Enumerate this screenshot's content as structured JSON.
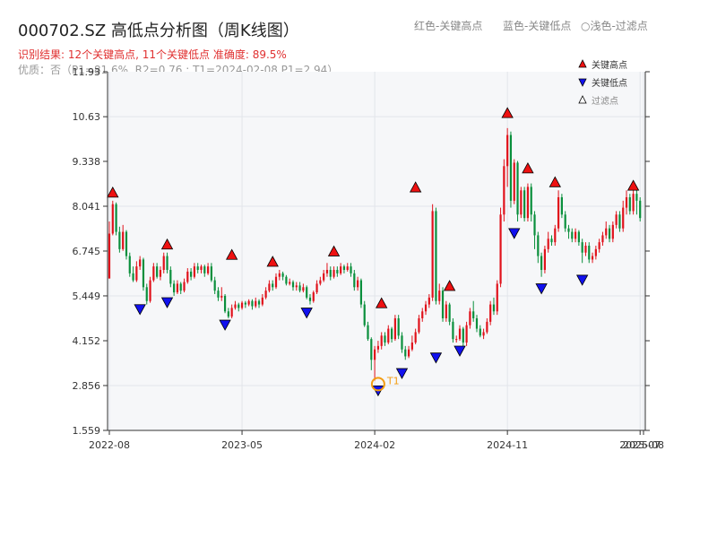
{
  "title": "000702.SZ 高低点分析图（周K线图）",
  "legend_text": {
    "red": "红色-关键高点",
    "blue": "蓝色-关键低点",
    "light": "○浅色-过滤点"
  },
  "info_line1": "识别结果: 12个关键高点, 11个关键低点  准确度: 89.5%",
  "info_line2": "优质：否（P1=81.6%, R2=0.76 ; T1=2024-02-08 P1=2.94）",
  "legend_box": {
    "high": "关键高点",
    "low": "关键低点",
    "filtered": "过滤点"
  },
  "colors": {
    "up": "#e0121b",
    "down": "#0a8f3c",
    "high_marker": "#ee1111",
    "low_marker": "#1111ee",
    "t1": "#f39c12",
    "plot_bg": "#f6f7f9"
  },
  "chart_data": {
    "type": "candlestick",
    "x_range_index": [
      0,
      157
    ],
    "ylim": [
      1.559,
      11.93
    ],
    "y_ticks": [
      "11.93",
      "10.63",
      "9.338",
      "8.041",
      "6.745",
      "5.449",
      "4.152",
      "2.856",
      "1.559"
    ],
    "x_ticks": [
      {
        "label": "2022-08",
        "index": 0
      },
      {
        "label": "2023-05",
        "index": 39
      },
      {
        "label": "2024-02",
        "index": 78
      },
      {
        "label": "2024-11",
        "index": 117
      },
      {
        "label": "2025-07",
        "index": 156
      },
      {
        "label": "2025-08",
        "index": 157
      }
    ],
    "candles": [
      [
        5.95,
        7.25,
        6.1,
        7.6
      ],
      [
        7.25,
        8.1,
        7.2,
        8.2
      ],
      [
        8.1,
        7.3,
        7.2,
        8.15
      ],
      [
        7.3,
        6.8,
        6.7,
        7.45
      ],
      [
        6.8,
        7.3,
        6.75,
        7.5
      ],
      [
        7.3,
        6.6,
        6.5,
        7.35
      ],
      [
        6.6,
        6.1,
        6.0,
        6.7
      ],
      [
        6.1,
        5.9,
        5.85,
        6.3
      ],
      [
        5.9,
        6.3,
        5.85,
        6.45
      ],
      [
        6.3,
        6.5,
        6.2,
        6.6
      ],
      [
        6.5,
        5.7,
        5.6,
        6.55
      ],
      [
        5.7,
        5.3,
        5.2,
        5.8
      ],
      [
        5.3,
        5.9,
        5.25,
        6.0
      ],
      [
        5.9,
        6.3,
        5.85,
        6.4
      ],
      [
        6.3,
        6.0,
        5.95,
        6.4
      ],
      [
        6.0,
        6.2,
        5.9,
        6.3
      ],
      [
        6.2,
        6.6,
        6.1,
        6.7
      ],
      [
        6.6,
        6.2,
        6.1,
        6.7
      ],
      [
        6.2,
        5.8,
        5.7,
        6.3
      ],
      [
        5.8,
        5.55,
        5.45,
        5.9
      ],
      [
        5.55,
        5.8,
        5.5,
        5.9
      ],
      [
        5.8,
        5.6,
        5.5,
        5.85
      ],
      [
        5.6,
        5.85,
        5.55,
        5.95
      ],
      [
        5.85,
        6.15,
        5.8,
        6.25
      ],
      [
        6.15,
        6.0,
        5.9,
        6.25
      ],
      [
        6.0,
        6.3,
        5.95,
        6.4
      ],
      [
        6.3,
        6.2,
        6.1,
        6.4
      ],
      [
        6.2,
        6.3,
        6.1,
        6.35
      ],
      [
        6.3,
        6.1,
        6.0,
        6.35
      ],
      [
        6.1,
        6.3,
        6.05,
        6.4
      ],
      [
        6.3,
        5.9,
        5.85,
        6.4
      ],
      [
        5.9,
        5.6,
        5.5,
        6.0
      ],
      [
        5.6,
        5.4,
        5.3,
        5.7
      ],
      [
        5.4,
        5.45,
        5.3,
        5.7
      ],
      [
        5.45,
        5.0,
        4.95,
        5.5
      ],
      [
        5.0,
        4.85,
        4.8,
        5.1
      ],
      [
        4.85,
        5.1,
        4.8,
        5.2
      ],
      [
        5.1,
        5.2,
        5.05,
        5.3
      ],
      [
        5.2,
        5.1,
        5.0,
        5.25
      ],
      [
        5.1,
        5.25,
        5.05,
        5.3
      ],
      [
        5.25,
        5.2,
        5.1,
        5.3
      ],
      [
        5.2,
        5.3,
        5.15,
        5.35
      ],
      [
        5.3,
        5.15,
        5.05,
        5.35
      ],
      [
        5.15,
        5.3,
        5.1,
        5.4
      ],
      [
        5.3,
        5.2,
        5.1,
        5.35
      ],
      [
        5.2,
        5.4,
        5.15,
        5.5
      ],
      [
        5.4,
        5.6,
        5.35,
        5.7
      ],
      [
        5.6,
        5.8,
        5.55,
        5.9
      ],
      [
        5.8,
        5.7,
        5.6,
        5.9
      ],
      [
        5.7,
        6.0,
        5.65,
        6.1
      ],
      [
        6.0,
        6.1,
        5.9,
        6.2
      ],
      [
        6.1,
        6.0,
        5.9,
        6.15
      ],
      [
        6.0,
        5.8,
        5.75,
        6.05
      ],
      [
        5.8,
        5.85,
        5.75,
        5.95
      ],
      [
        5.85,
        5.7,
        5.6,
        5.9
      ],
      [
        5.7,
        5.75,
        5.6,
        5.85
      ],
      [
        5.75,
        5.6,
        5.55,
        5.85
      ],
      [
        5.6,
        5.7,
        5.55,
        5.8
      ],
      [
        5.7,
        5.4,
        5.35,
        5.75
      ],
      [
        5.4,
        5.3,
        5.2,
        5.5
      ],
      [
        5.3,
        5.55,
        5.25,
        5.6
      ],
      [
        5.55,
        5.8,
        5.5,
        5.9
      ],
      [
        5.8,
        5.9,
        5.75,
        6.0
      ],
      [
        5.9,
        6.1,
        5.85,
        6.2
      ],
      [
        6.1,
        6.2,
        6.0,
        6.4
      ],
      [
        6.2,
        6.0,
        5.9,
        6.3
      ],
      [
        6.0,
        6.2,
        5.95,
        6.3
      ],
      [
        6.2,
        6.1,
        6.0,
        6.3
      ],
      [
        6.1,
        6.3,
        6.05,
        6.4
      ],
      [
        6.3,
        6.2,
        6.1,
        6.35
      ],
      [
        6.2,
        6.3,
        6.15,
        6.4
      ],
      [
        6.3,
        6.1,
        6.0,
        6.4
      ],
      [
        6.1,
        5.7,
        5.6,
        6.2
      ],
      [
        5.7,
        5.9,
        5.6,
        6.0
      ],
      [
        5.9,
        5.2,
        5.1,
        5.95
      ],
      [
        5.2,
        4.6,
        4.55,
        5.3
      ],
      [
        4.6,
        4.2,
        4.15,
        4.7
      ],
      [
        4.2,
        3.6,
        3.3,
        4.25
      ],
      [
        3.6,
        3.9,
        3.0,
        4.0
      ],
      [
        3.9,
        4.0,
        3.8,
        4.15
      ],
      [
        4.0,
        4.3,
        3.9,
        4.4
      ],
      [
        4.3,
        4.1,
        4.0,
        4.4
      ],
      [
        4.1,
        4.5,
        4.05,
        4.6
      ],
      [
        4.5,
        4.2,
        4.1,
        4.55
      ],
      [
        4.2,
        4.8,
        4.15,
        4.9
      ],
      [
        4.8,
        4.3,
        4.2,
        4.9
      ],
      [
        4.3,
        3.9,
        3.8,
        4.4
      ],
      [
        3.9,
        3.7,
        3.6,
        4.0
      ],
      [
        3.7,
        3.9,
        3.65,
        4.0
      ],
      [
        3.9,
        4.1,
        3.85,
        4.3
      ],
      [
        4.1,
        4.4,
        4.05,
        4.5
      ],
      [
        4.4,
        4.8,
        4.35,
        4.9
      ],
      [
        4.8,
        5.0,
        4.7,
        5.1
      ],
      [
        5.0,
        5.2,
        4.9,
        5.3
      ],
      [
        5.2,
        5.4,
        5.1,
        5.5
      ],
      [
        5.4,
        7.9,
        5.3,
        8.1
      ],
      [
        7.9,
        5.3,
        5.2,
        8.0
      ],
      [
        5.3,
        5.6,
        5.2,
        5.8
      ],
      [
        5.6,
        4.8,
        4.7,
        5.7
      ],
      [
        4.8,
        5.2,
        4.7,
        5.3
      ],
      [
        5.2,
        4.7,
        4.6,
        5.25
      ],
      [
        4.7,
        4.2,
        4.1,
        4.8
      ],
      [
        4.2,
        4.2,
        4.1,
        4.3
      ],
      [
        4.2,
        4.5,
        4.15,
        4.6
      ],
      [
        4.5,
        4.1,
        4.0,
        4.55
      ],
      [
        4.1,
        4.6,
        4.0,
        4.7
      ],
      [
        4.6,
        5.0,
        4.5,
        5.1
      ],
      [
        5.0,
        4.8,
        4.7,
        5.3
      ],
      [
        4.8,
        4.5,
        4.4,
        4.9
      ],
      [
        4.5,
        4.3,
        4.25,
        4.6
      ],
      [
        4.3,
        4.4,
        4.2,
        4.5
      ],
      [
        4.4,
        4.7,
        4.35,
        4.8
      ],
      [
        4.7,
        5.2,
        4.6,
        5.3
      ],
      [
        5.2,
        5.0,
        4.9,
        5.4
      ],
      [
        5.0,
        5.8,
        4.9,
        5.9
      ],
      [
        5.8,
        7.8,
        5.7,
        8.0
      ],
      [
        7.8,
        9.2,
        7.6,
        9.4
      ],
      [
        9.2,
        10.1,
        8.6,
        10.3
      ],
      [
        10.1,
        8.2,
        8.0,
        10.2
      ],
      [
        8.2,
        9.3,
        8.1,
        9.4
      ],
      [
        9.3,
        7.8,
        7.6,
        9.35
      ],
      [
        7.8,
        8.5,
        7.7,
        8.6
      ],
      [
        8.5,
        7.7,
        7.6,
        8.6
      ],
      [
        7.7,
        8.6,
        7.6,
        8.7
      ],
      [
        8.6,
        7.8,
        7.6,
        8.7
      ],
      [
        7.8,
        7.2,
        6.8,
        7.9
      ],
      [
        7.2,
        6.6,
        6.4,
        7.3
      ],
      [
        6.6,
        6.2,
        6.0,
        6.7
      ],
      [
        6.2,
        6.8,
        6.1,
        6.9
      ],
      [
        6.8,
        7.1,
        6.7,
        7.3
      ],
      [
        7.1,
        7.0,
        6.9,
        7.2
      ],
      [
        7.0,
        7.4,
        6.9,
        7.5
      ],
      [
        7.4,
        8.3,
        7.3,
        8.5
      ],
      [
        8.3,
        7.8,
        7.7,
        8.4
      ],
      [
        7.8,
        7.4,
        7.3,
        7.9
      ],
      [
        7.4,
        7.3,
        7.1,
        7.5
      ],
      [
        7.3,
        7.1,
        7.0,
        7.4
      ],
      [
        7.1,
        7.3,
        7.0,
        7.4
      ],
      [
        7.3,
        7.0,
        6.9,
        7.35
      ],
      [
        7.0,
        6.7,
        6.4,
        7.1
      ],
      [
        6.7,
        6.9,
        6.6,
        7.0
      ],
      [
        6.9,
        6.5,
        6.4,
        7.0
      ],
      [
        6.5,
        6.6,
        6.4,
        6.7
      ],
      [
        6.6,
        6.8,
        6.5,
        6.9
      ],
      [
        6.8,
        7.0,
        6.7,
        7.1
      ],
      [
        7.0,
        7.2,
        6.9,
        7.3
      ],
      [
        7.2,
        7.4,
        7.1,
        7.6
      ],
      [
        7.4,
        7.1,
        7.0,
        7.5
      ],
      [
        7.1,
        7.5,
        7.0,
        7.6
      ],
      [
        7.5,
        7.8,
        7.4,
        7.9
      ],
      [
        7.8,
        7.4,
        7.3,
        7.9
      ],
      [
        7.4,
        8.0,
        7.3,
        8.2
      ],
      [
        8.0,
        8.3,
        7.8,
        8.5
      ],
      [
        8.3,
        7.9,
        7.8,
        8.4
      ],
      [
        7.9,
        8.4,
        7.8,
        8.5
      ],
      [
        8.4,
        8.2,
        7.8,
        8.6
      ],
      [
        8.2,
        7.7,
        7.6,
        8.3
      ]
    ],
    "high_points": [
      {
        "index": 1,
        "price": 8.2
      },
      {
        "index": 17,
        "price": 6.7
      },
      {
        "index": 36,
        "price": 6.4
      },
      {
        "index": 48,
        "price": 6.2
      },
      {
        "index": 66,
        "price": 6.5
      },
      {
        "index": 80,
        "price": 5.0
      },
      {
        "index": 90,
        "price": 8.35
      },
      {
        "index": 100,
        "price": 5.5
      },
      {
        "index": 117,
        "price": 10.5
      },
      {
        "index": 123,
        "price": 8.9
      },
      {
        "index": 131,
        "price": 8.5
      },
      {
        "index": 154,
        "price": 8.4
      }
    ],
    "low_points": [
      {
        "index": 9,
        "price": 5.3
      },
      {
        "index": 17,
        "price": 5.5
      },
      {
        "index": 34,
        "price": 4.85
      },
      {
        "index": 58,
        "price": 5.2
      },
      {
        "index": 79,
        "price": 2.95
      },
      {
        "index": 86,
        "price": 3.45
      },
      {
        "index": 96,
        "price": 3.9
      },
      {
        "index": 103,
        "price": 4.1
      },
      {
        "index": 119,
        "price": 7.5
      },
      {
        "index": 127,
        "price": 5.9
      },
      {
        "index": 139,
        "price": 6.15
      }
    ],
    "t1": {
      "label": "T1",
      "index": 79,
      "price": 2.95
    }
  }
}
